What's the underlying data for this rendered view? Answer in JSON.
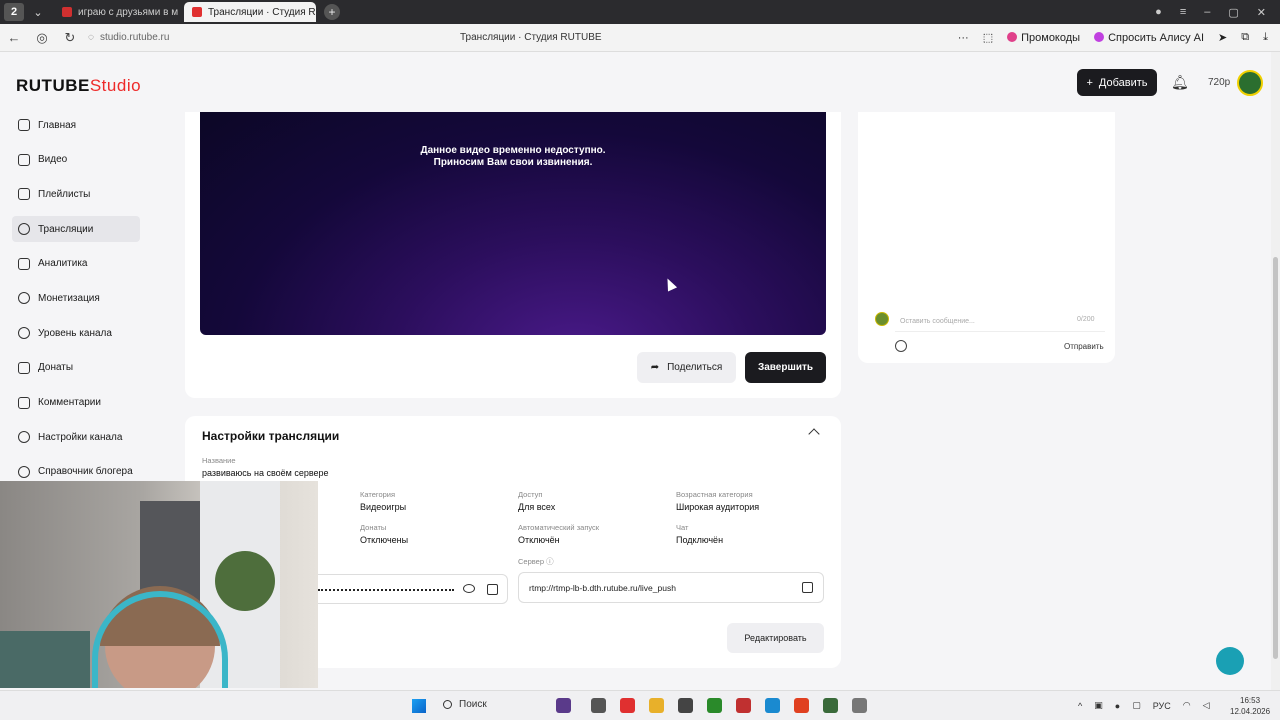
{
  "browser": {
    "tab_number": "2",
    "tabs": [
      {
        "label": "играю с друзьями в майн"
      },
      {
        "label": "Трансляции · Студия R"
      }
    ],
    "url": "studio.rutube.ru",
    "page_title": "Трансляции · Студия RUTUBE",
    "promo_label": "Промокоды",
    "alice_label": "Спросить Алису AI"
  },
  "header": {
    "logo_main": "RUTUBE",
    "logo_suffix": "Studio",
    "add_button": "Добавить",
    "quality": "720p"
  },
  "sidebar": {
    "items": [
      {
        "label": "Главная"
      },
      {
        "label": "Видео"
      },
      {
        "label": "Плейлисты"
      },
      {
        "label": "Трансляции"
      },
      {
        "label": "Аналитика"
      },
      {
        "label": "Монетизация"
      },
      {
        "label": "Уровень канала"
      },
      {
        "label": "Донаты"
      },
      {
        "label": "Комментарии"
      },
      {
        "label": "Настройки канала"
      },
      {
        "label": "Справочник блогера"
      }
    ]
  },
  "player": {
    "message_line1": "Данное видео временно недоступно.",
    "message_line2": "Приносим Вам свои извинения.",
    "share_button": "Поделиться",
    "end_button": "Завершить"
  },
  "chat": {
    "placeholder": "Оставить сообщение...",
    "counter": "0/200",
    "send_button": "Отправить"
  },
  "settings": {
    "title": "Настройки трансляции",
    "name_label": "Название",
    "name_value": "развиваюсь на своём сервере",
    "fields": {
      "category_label": "Категория",
      "category_value": "Видеоигры",
      "access_label": "Доступ",
      "access_value": "Для всех",
      "age_label": "Возрастная категория",
      "age_value": "Широкая аудитория",
      "donations_label": "Донаты",
      "donations_value": "Отключены",
      "autostart_label": "Автоматический запуск",
      "autostart_value": "Отключён",
      "chat_label": "Чат",
      "chat_value": "Подключён"
    },
    "server_label": "Сервер",
    "server_value": "rtmp://rtmp-lb-b.dth.rutube.ru/live_push",
    "edit_button": "Редактировать"
  },
  "taskbar": {
    "search_label": "Поиск",
    "lang": "РУС",
    "time": "16:53",
    "date": "12.04.2026"
  }
}
